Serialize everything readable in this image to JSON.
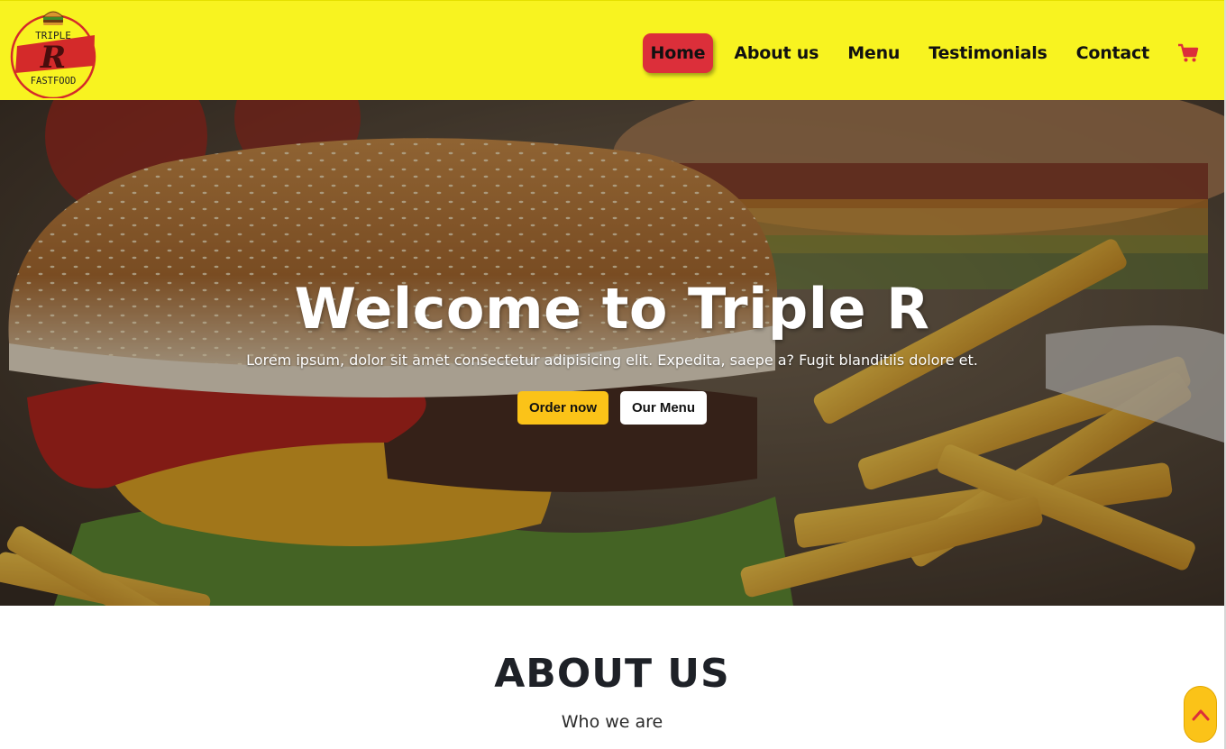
{
  "brand": {
    "logo_top_text": "TRIPLE",
    "logo_letter": "R",
    "logo_bottom_text": "FASTFOOD",
    "nav_bg": "#f8f320",
    "accent_red": "#dc2f3a",
    "accent_yellow": "#fbc318"
  },
  "nav": {
    "items": [
      {
        "label": "Home",
        "active": true
      },
      {
        "label": "About us"
      },
      {
        "label": "Menu"
      },
      {
        "label": "Testimonials"
      },
      {
        "label": "Contact"
      }
    ],
    "cart_icon": "cart-icon"
  },
  "hero": {
    "title": "Welcome to Triple R",
    "subtitle": "Lorem ipsum, dolor sit amet consectetur adipisicing elit. Expedita, saepe a? Fugit blanditiis dolore et.",
    "primary_button": "Order now",
    "secondary_button": "Our Menu",
    "background_image": "burger-and-fries-photo"
  },
  "about": {
    "title": "ABOUT US",
    "subtitle": "Who we are"
  },
  "scroll_top": {
    "icon": "chevron-up-icon"
  }
}
